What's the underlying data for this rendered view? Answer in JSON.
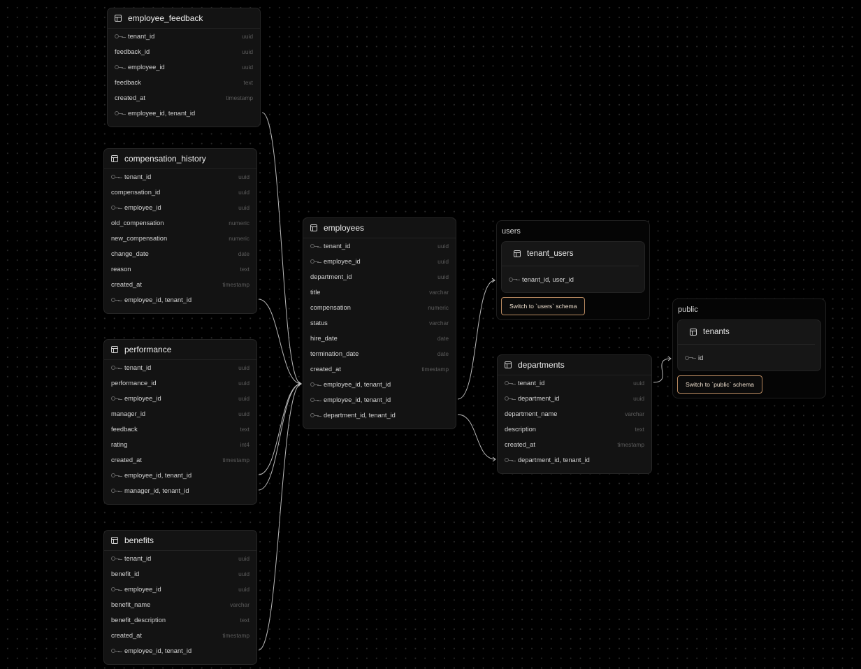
{
  "tables": {
    "employee_feedback": {
      "name": "employee_feedback",
      "columns": [
        {
          "key": true,
          "name": "tenant_id",
          "type": "uuid"
        },
        {
          "key": false,
          "name": "feedback_id",
          "type": "uuid"
        },
        {
          "key": true,
          "name": "employee_id",
          "type": "uuid"
        },
        {
          "key": false,
          "name": "feedback",
          "type": "text"
        },
        {
          "key": false,
          "name": "created_at",
          "type": "timestamp"
        },
        {
          "key": true,
          "name": "employee_id, tenant_id",
          "type": ""
        }
      ]
    },
    "compensation_history": {
      "name": "compensation_history",
      "columns": [
        {
          "key": true,
          "name": "tenant_id",
          "type": "uuid"
        },
        {
          "key": false,
          "name": "compensation_id",
          "type": "uuid"
        },
        {
          "key": true,
          "name": "employee_id",
          "type": "uuid"
        },
        {
          "key": false,
          "name": "old_compensation",
          "type": "numeric"
        },
        {
          "key": false,
          "name": "new_compensation",
          "type": "numeric"
        },
        {
          "key": false,
          "name": "change_date",
          "type": "date"
        },
        {
          "key": false,
          "name": "reason",
          "type": "text"
        },
        {
          "key": false,
          "name": "created_at",
          "type": "timestamp"
        },
        {
          "key": true,
          "name": "employee_id, tenant_id",
          "type": ""
        }
      ]
    },
    "performance": {
      "name": "performance",
      "columns": [
        {
          "key": true,
          "name": "tenant_id",
          "type": "uuid"
        },
        {
          "key": false,
          "name": "performance_id",
          "type": "uuid"
        },
        {
          "key": true,
          "name": "employee_id",
          "type": "uuid"
        },
        {
          "key": false,
          "name": "manager_id",
          "type": "uuid"
        },
        {
          "key": false,
          "name": "feedback",
          "type": "text"
        },
        {
          "key": false,
          "name": "rating",
          "type": "int4"
        },
        {
          "key": false,
          "name": "created_at",
          "type": "timestamp"
        },
        {
          "key": true,
          "name": "employee_id, tenant_id",
          "type": ""
        },
        {
          "key": true,
          "name": "manager_id, tenant_id",
          "type": ""
        }
      ]
    },
    "benefits": {
      "name": "benefits",
      "columns": [
        {
          "key": true,
          "name": "tenant_id",
          "type": "uuid"
        },
        {
          "key": false,
          "name": "benefit_id",
          "type": "uuid"
        },
        {
          "key": true,
          "name": "employee_id",
          "type": "uuid"
        },
        {
          "key": false,
          "name": "benefit_name",
          "type": "varchar"
        },
        {
          "key": false,
          "name": "benefit_description",
          "type": "text"
        },
        {
          "key": false,
          "name": "created_at",
          "type": "timestamp"
        },
        {
          "key": true,
          "name": "employee_id, tenant_id",
          "type": ""
        }
      ]
    },
    "employees": {
      "name": "employees",
      "columns": [
        {
          "key": true,
          "name": "tenant_id",
          "type": "uuid"
        },
        {
          "key": true,
          "name": "employee_id",
          "type": "uuid"
        },
        {
          "key": false,
          "name": "department_id",
          "type": "uuid"
        },
        {
          "key": false,
          "name": "title",
          "type": "varchar"
        },
        {
          "key": false,
          "name": "compensation",
          "type": "numeric"
        },
        {
          "key": false,
          "name": "status",
          "type": "varchar"
        },
        {
          "key": false,
          "name": "hire_date",
          "type": "date"
        },
        {
          "key": false,
          "name": "termination_date",
          "type": "date"
        },
        {
          "key": false,
          "name": "created_at",
          "type": "timestamp"
        },
        {
          "key": true,
          "name": "employee_id, tenant_id",
          "type": ""
        },
        {
          "key": true,
          "name": "employee_id, tenant_id",
          "type": ""
        },
        {
          "key": true,
          "name": "department_id, tenant_id",
          "type": ""
        }
      ]
    },
    "departments": {
      "name": "departments",
      "columns": [
        {
          "key": true,
          "name": "tenant_id",
          "type": "uuid"
        },
        {
          "key": true,
          "name": "department_id",
          "type": "uuid"
        },
        {
          "key": false,
          "name": "department_name",
          "type": "varchar"
        },
        {
          "key": false,
          "name": "description",
          "type": "text"
        },
        {
          "key": false,
          "name": "created_at",
          "type": "timestamp"
        },
        {
          "key": true,
          "name": "department_id, tenant_id",
          "type": ""
        }
      ]
    }
  },
  "schemas": {
    "users": {
      "name": "users",
      "table": "tenant_users",
      "column": "tenant_id, user_id",
      "switch_label": "Switch to `users` schema"
    },
    "public": {
      "name": "public",
      "table": "tenants",
      "column": "id",
      "switch_label": "Switch to `public` schema"
    }
  },
  "colors": {
    "background": "#000000",
    "card": "#131313",
    "edge": "#b8b8b8",
    "switch_border": "#b98a60"
  }
}
